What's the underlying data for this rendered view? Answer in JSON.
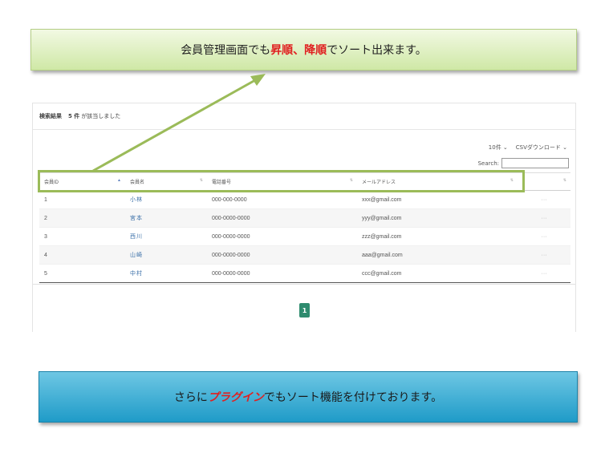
{
  "callout_top": {
    "before": "会員管理画面でも",
    "highlight": "昇順、降順",
    "after": "でソート出来ます。"
  },
  "panel": {
    "result_label": "検索結果",
    "result_count": "5 件",
    "result_suffix": "が該当しました",
    "per_page": "10件 ⌄",
    "csv_download": "CSVダウンロード ⌄",
    "search_label": "Search:",
    "search_value": ""
  },
  "table": {
    "headers": [
      "会員ID",
      "会員名",
      "電話番号",
      "メールアドレス",
      ""
    ],
    "rows": [
      {
        "id": "1",
        "name": "小林",
        "tel": "000-000-0000",
        "mail": "xxx@gmail.com",
        "more": "···"
      },
      {
        "id": "2",
        "name": "宮本",
        "tel": "000-0000-0000",
        "mail": "yyy@gmail.com",
        "more": "···"
      },
      {
        "id": "3",
        "name": "西川",
        "tel": "000-0000-0000",
        "mail": "zzz@gmail.com",
        "more": "···"
      },
      {
        "id": "4",
        "name": "山崎",
        "tel": "000-0000-0000",
        "mail": "aaa@gmail.com",
        "more": "···"
      },
      {
        "id": "5",
        "name": "中村",
        "tel": "000-0000-0000",
        "mail": "ccc@gmail.com",
        "more": "···"
      }
    ]
  },
  "pagination": {
    "current": "1"
  },
  "callout_bottom": {
    "before": "さらに",
    "highlight": "プラグイン",
    "after": "でもソート機能を付けております。"
  },
  "colors": {
    "accent_green": "#9bbb59",
    "highlight_red": "#e02020",
    "pager_green": "#2e8b6e",
    "callout_blue": "#1f9bc8"
  }
}
